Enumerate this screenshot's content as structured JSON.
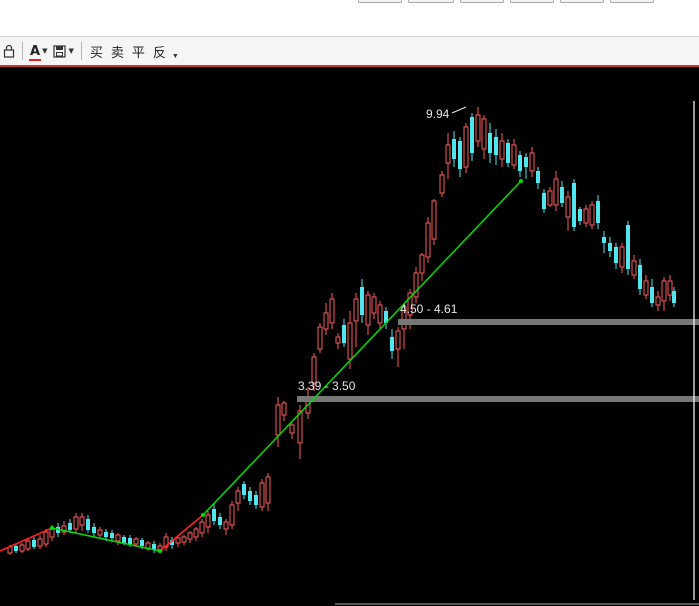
{
  "toolbar": {
    "lock_icon": "lock-icon",
    "font_color_letter": "A",
    "save_icon": "save-icon",
    "buttons": [
      "买",
      "卖",
      "平",
      "反"
    ]
  },
  "colors": {
    "background": "#000000",
    "up_candle": "#ff5a5a",
    "down_candle": "#4fe6ee",
    "down_trend": "#00dd00",
    "up_trend": "#ff2020",
    "zone": "#777777",
    "label": "#e6e6e6",
    "toolbar_accent": "#c0392b"
  },
  "annotations": {
    "peak_label": "9.94",
    "zone_upper_label": "4.50 - 4.61",
    "zone_lower_label": "3.39 - 3.50"
  },
  "chart_data": {
    "type": "candlestick",
    "price_levels": {
      "peak": 9.94,
      "zone_upper": [
        4.5,
        4.61
      ],
      "zone_lower": [
        3.39,
        3.5
      ]
    }
  }
}
